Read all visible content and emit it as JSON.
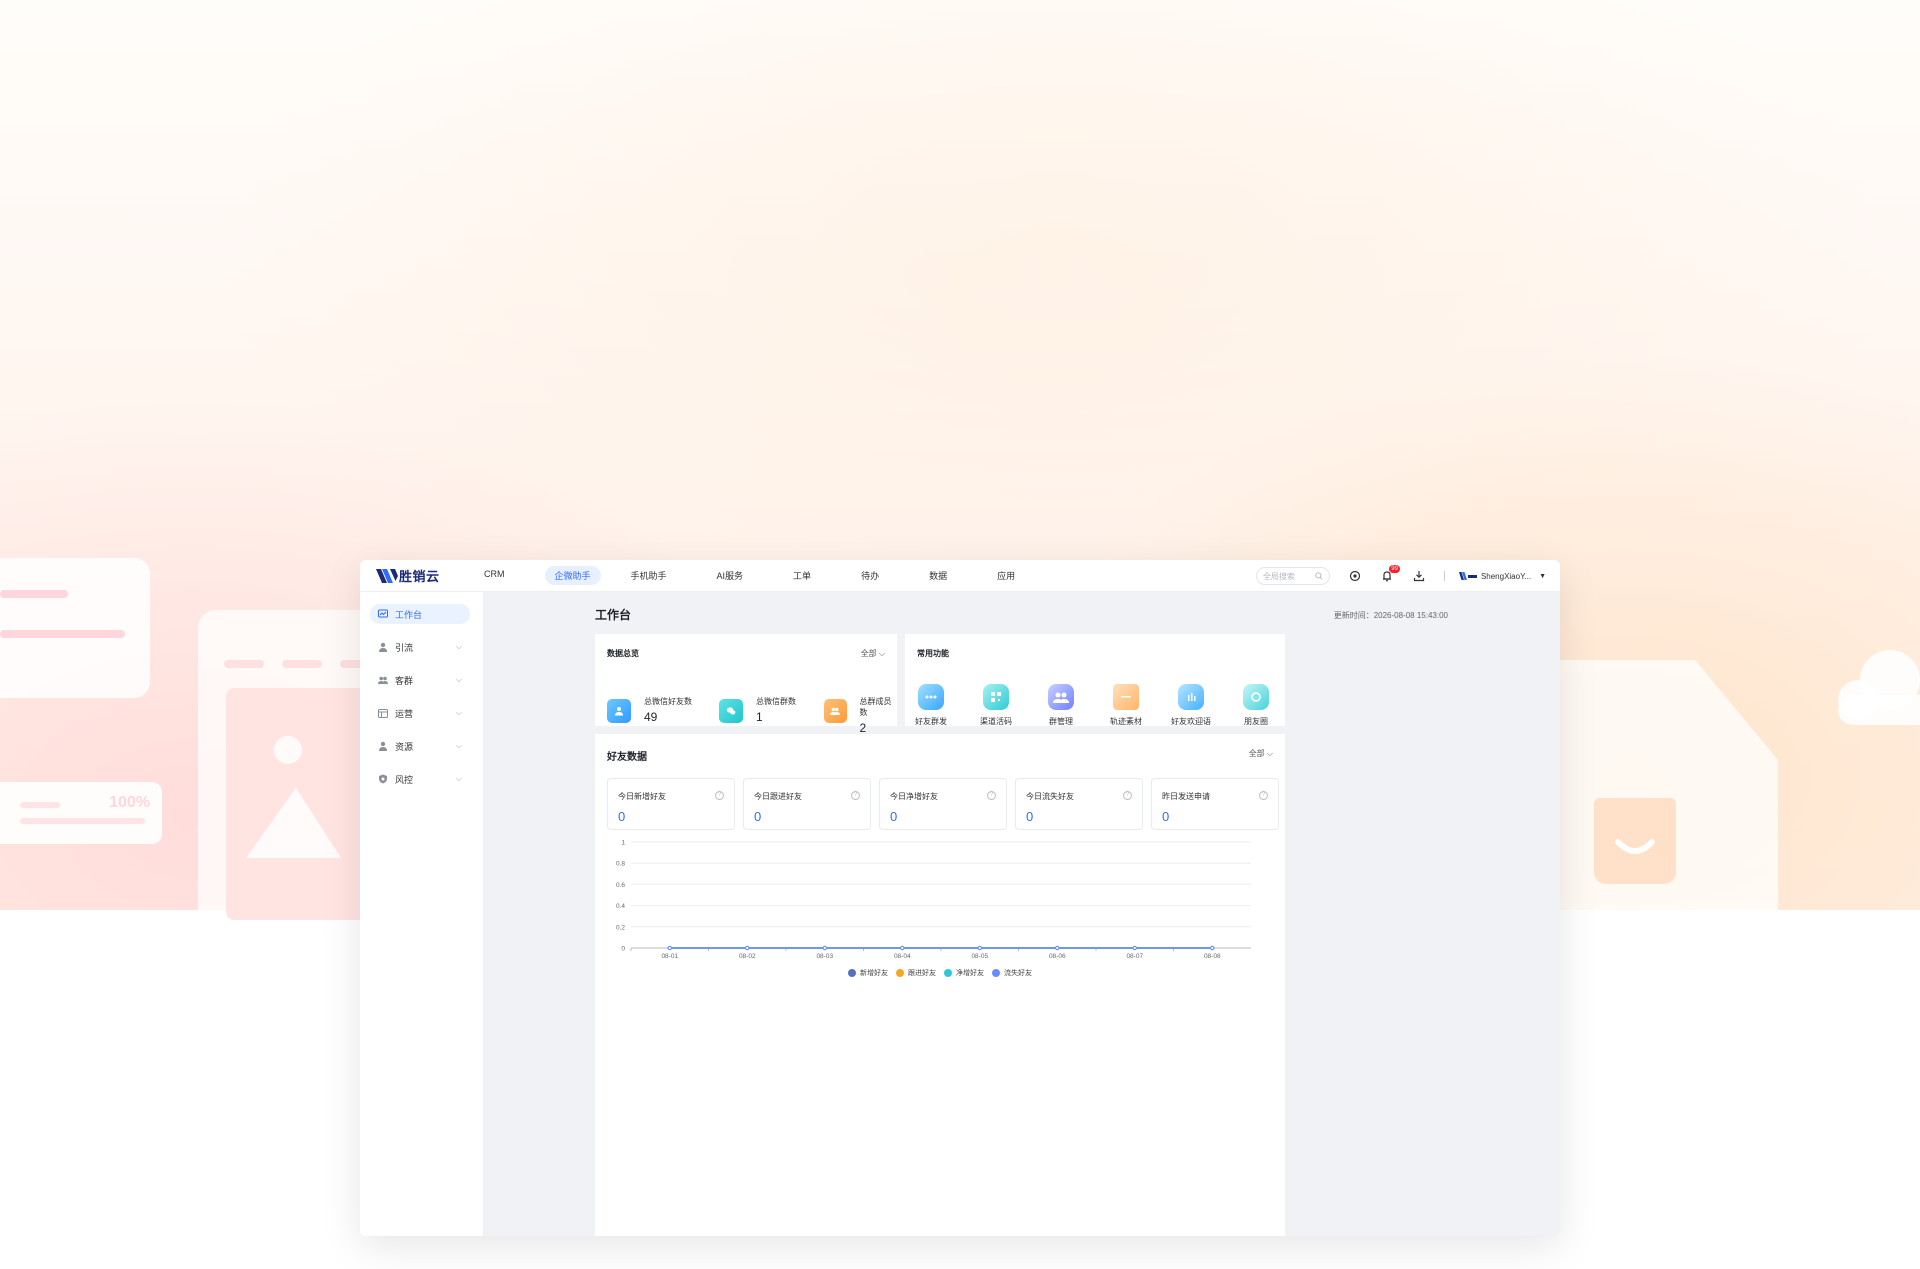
{
  "app": {
    "logo_text": "胜销云",
    "nav": [
      {
        "label": "CRM",
        "active": false
      },
      {
        "label": "企微助手",
        "active": true
      },
      {
        "label": "手机助手",
        "active": false
      },
      {
        "label": "AI服务",
        "active": false
      },
      {
        "label": "工单",
        "active": false
      },
      {
        "label": "待办",
        "active": false
      },
      {
        "label": "数据",
        "active": false
      },
      {
        "label": "应用",
        "active": false
      }
    ],
    "search_placeholder": "全局搜索",
    "notification_count": "99",
    "user_name": "ShengXiaoY..."
  },
  "sidebar": {
    "items": [
      {
        "label": "工作台",
        "icon": "dashboard-icon",
        "active": true
      },
      {
        "label": "引流",
        "icon": "user-icon",
        "active": false
      },
      {
        "label": "客群",
        "icon": "group-icon",
        "active": false
      },
      {
        "label": "运营",
        "icon": "calendar-icon",
        "active": false
      },
      {
        "label": "资源",
        "icon": "user-icon",
        "active": false
      },
      {
        "label": "风控",
        "icon": "shield-icon",
        "active": false
      }
    ]
  },
  "main": {
    "page_title": "工作台",
    "update_time": "更新时间：2026-08-08 15:43:00",
    "overview": {
      "title": "数据总览",
      "filter": "全部",
      "stats": [
        {
          "label": "总微信好友数",
          "value": "49",
          "color": "#4cb4ff"
        },
        {
          "label": "总微信群数",
          "value": "1",
          "color": "#2fd3d9"
        },
        {
          "label": "总群成员数",
          "value": "2",
          "color": "#ffa54c"
        }
      ]
    },
    "functions": {
      "title": "常用功能",
      "items": [
        {
          "label": "好友群发",
          "icon": "chat-icon",
          "color": "#4ab8ff"
        },
        {
          "label": "渠道活码",
          "icon": "qrcode-icon",
          "color": "#3ed1d6"
        },
        {
          "label": "群管理",
          "icon": "group-icon",
          "color": "#7d8cff"
        },
        {
          "label": "轨迹素材",
          "icon": "folder-icon",
          "color": "#ffb56b"
        },
        {
          "label": "好友欢迎语",
          "icon": "welcome-icon",
          "color": "#4ab8ff"
        },
        {
          "label": "朋友圈",
          "icon": "moments-icon",
          "color": "#3ed1d6"
        }
      ]
    },
    "friends": {
      "title": "好友数据",
      "filter": "全部",
      "kpis": [
        {
          "label": "今日新增好友",
          "value": "0"
        },
        {
          "label": "今日跟进好友",
          "value": "0"
        },
        {
          "label": "今日净增好友",
          "value": "0"
        },
        {
          "label": "今日流失好友",
          "value": "0"
        },
        {
          "label": "昨日发送申请",
          "value": "0"
        }
      ]
    }
  },
  "chart_data": {
    "type": "line",
    "x": [
      "08-01",
      "08-02",
      "08-03",
      "08-04",
      "08-05",
      "08-06",
      "08-07",
      "08-08"
    ],
    "ylim": [
      0,
      1
    ],
    "yticks": [
      "0",
      "0.2",
      "0.4",
      "0.6",
      "0.8",
      "1"
    ],
    "grid": true,
    "legend_position": "bottom",
    "series": [
      {
        "name": "新增好友",
        "color": "#5470c6",
        "values": [
          0,
          0,
          0,
          0,
          0,
          0,
          0,
          0
        ]
      },
      {
        "name": "跟进好友",
        "color": "#f5a623",
        "values": [
          0,
          0,
          0,
          0,
          0,
          0,
          0,
          0
        ]
      },
      {
        "name": "净增好友",
        "color": "#2fc8d8",
        "values": [
          0,
          0,
          0,
          0,
          0,
          0,
          0,
          0
        ]
      },
      {
        "name": "流失好友",
        "color": "#6a8cff",
        "values": [
          0,
          0,
          0,
          0,
          0,
          0,
          0,
          0
        ]
      }
    ]
  }
}
